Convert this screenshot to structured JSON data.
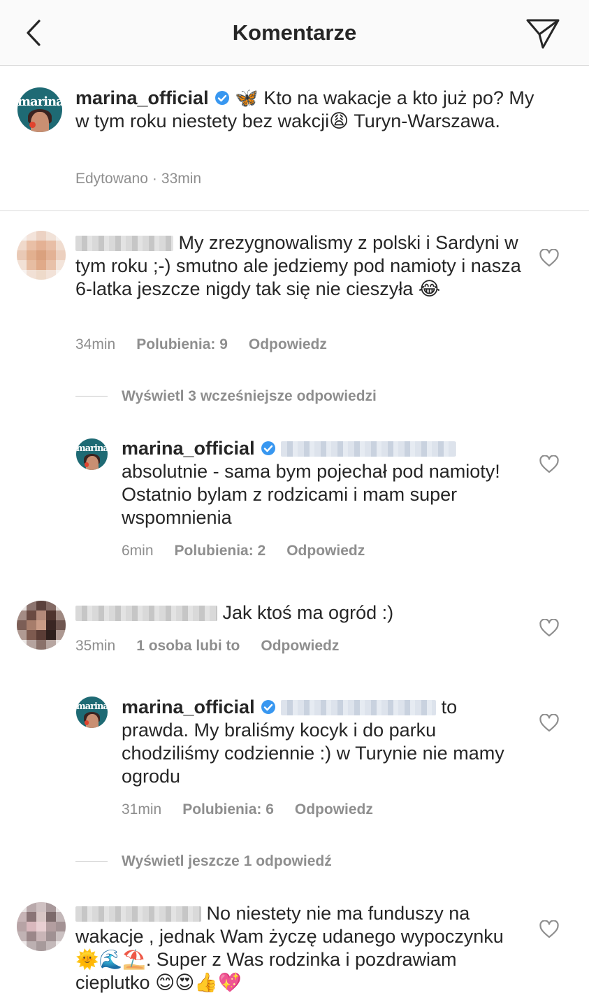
{
  "header": {
    "title": "Komentarze"
  },
  "caption": {
    "user": "marina_official",
    "text_part1": " 🦋 Kto na wakacje a kto już po? My w tym roku niestety bez wakcji",
    "emoji1": "😩",
    "text_part2": " Turyn-Warszawa.",
    "edited": "Edytowano",
    "sep": "·",
    "time": "33min"
  },
  "comments": [
    {
      "text": "My zrezygnowalismy z polski i Sardyni w tym roku ;-) smutno ale jedziemy pod namioty i nasza 6-latka jeszcze nigdy tak się nie cieszyła ",
      "emoji": "😂",
      "time": "34min",
      "likes": "Polubienia: 9",
      "reply": "Odpowiedz"
    },
    {
      "text": "Jak ktoś ma ogród :)",
      "time": "35min",
      "likes": "1 osoba lubi to",
      "reply": "Odpowiedz"
    },
    {
      "text": "No niestety nie ma funduszy na wakacje , jednak Wam życzę udanego wypoczynku ",
      "emojis_a": "🌞🌊⛱️",
      "text2": ". Super z Was rodzinka i pozdrawiam cieplutko ",
      "emojis_b": "😊😍👍💖"
    }
  ],
  "replies": [
    {
      "user": "marina_official",
      "text": "absolutnie - sama bym pojechał pod namioty! Ostatnio bylam z rodzicami i mam super wspomnienia",
      "time": "6min",
      "likes": "Polubienia: 2",
      "reply": "Odpowiedz"
    },
    {
      "user": "marina_official",
      "text_inline": "to",
      "text": "prawda. My braliśmy kocyk i do parku chodziliśmy codziennie :) w Turynie nie mamy ogrodu",
      "time": "31min",
      "likes": "Polubienia: 6",
      "reply": "Odpowiedz"
    }
  ],
  "toggles": {
    "earlier": "Wyświetl 3 wcześniejsze odpowiedzi",
    "more": "Wyświetl jeszcze 1 odpowiedź"
  },
  "colors": {
    "accent": "#3897f0",
    "secondary_text": "#8e8e8e",
    "divider": "#dbdbdb",
    "header_bg": "#fafafa"
  },
  "icons": [
    "back-chevron-icon",
    "send-icon",
    "verified-badge-icon",
    "heart-icon"
  ]
}
